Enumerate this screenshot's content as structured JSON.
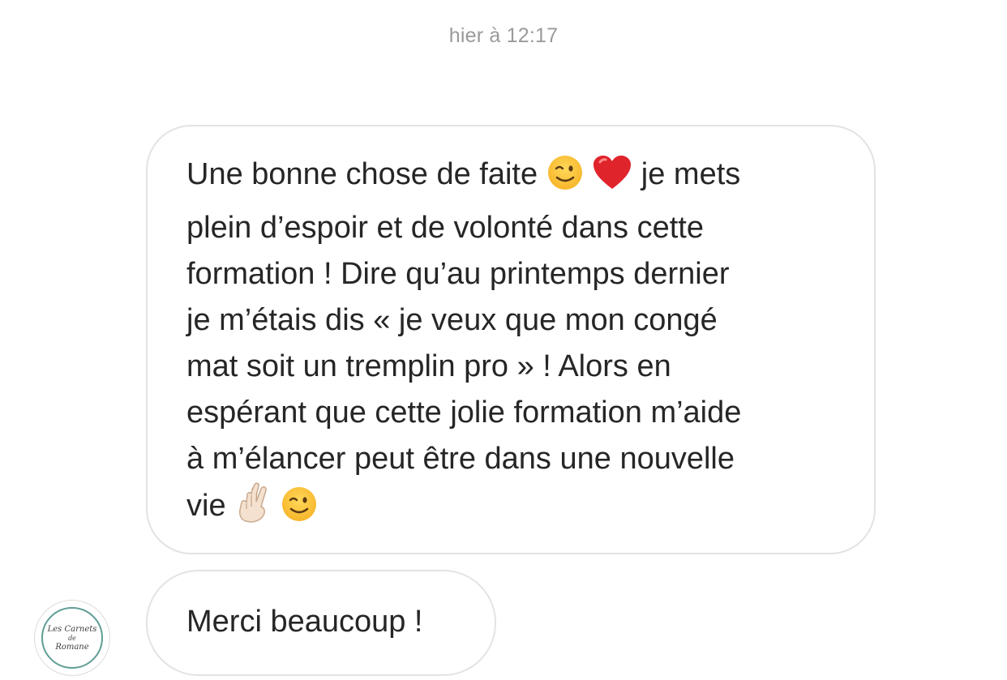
{
  "conversation": {
    "timestamp": "hier à 12:17"
  },
  "messages": [
    {
      "lines": [
        "Une bonne chose de faite ",
        " je mets",
        "plein d’espoir et de volonté dans cette",
        "formation ! Dire qu’au printemps dernier",
        "je m’étais dis « je veux que mon congé",
        "mat soit un tremplin pro » ! Alors en",
        "espérant que cette jolie formation m’aide",
        "à m’élancer peut être dans une nouvelle",
        "vie "
      ],
      "emojis": [
        "winking-face",
        "red-heart",
        "crossed-fingers",
        "winking-face"
      ]
    },
    {
      "text": "Merci beaucoup !"
    }
  ],
  "avatar": {
    "line1": "Les Carnets",
    "line2": "de",
    "line3": "Romane",
    "ring_color": "#5f9e96"
  },
  "colors": {
    "bubble_border": "#e3e3e3",
    "text": "#262626",
    "timestamp": "#9a9a9a"
  }
}
